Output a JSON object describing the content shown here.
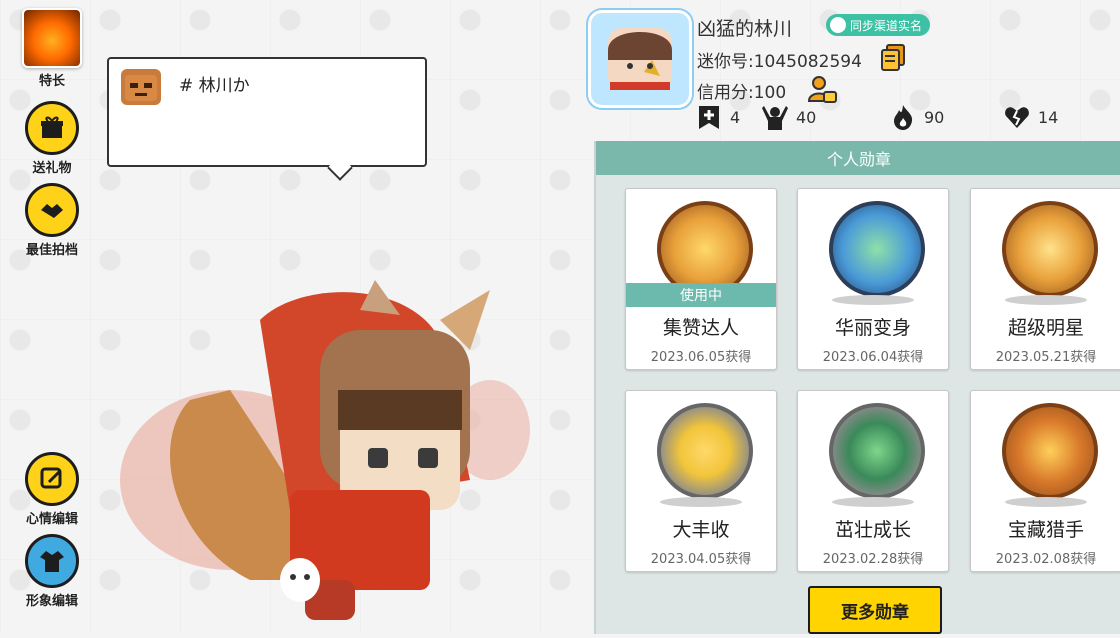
{
  "left_menu": {
    "talent_label": "特长",
    "gift_label": "送礼物",
    "partner_label": "最佳拍档",
    "mood_label": "心情编辑",
    "image_label": "形象编辑"
  },
  "bubble": {
    "text": "# 林川か"
  },
  "profile": {
    "nickname": "凶猛的林川",
    "sync_badge": "同步渠道实名",
    "mini_id": "迷你号:1045082594",
    "credit": "信用分:100",
    "stats": {
      "bookmark": "4",
      "fans": "40",
      "fire": "90",
      "heart": "14"
    }
  },
  "panel": {
    "title": "个人勋章",
    "in_use_label": "使用中",
    "medals": [
      {
        "name": "集赞达人",
        "date": "2023.06.05获得",
        "color": "#c87b3a"
      },
      {
        "name": "华丽变身",
        "date": "2023.06.04获得",
        "color": "#3a7fc0"
      },
      {
        "name": "超级明星",
        "date": "2023.05.21获得",
        "color": "#c87b3a"
      },
      {
        "name": "大丰收",
        "date": "2023.04.05获得",
        "color": "#9a9a9a"
      },
      {
        "name": "茁壮成长",
        "date": "2023.02.28获得",
        "color": "#9a9a9a"
      },
      {
        "name": "宝藏猎手",
        "date": "2023.02.08获得",
        "color": "#c87b3a"
      }
    ],
    "more_button": "更多勋章"
  }
}
